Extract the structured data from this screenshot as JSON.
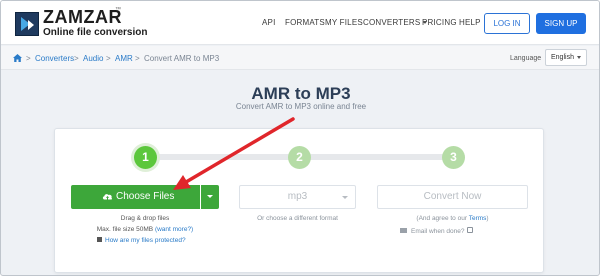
{
  "header": {
    "brand": "ZAMZAR",
    "trademark": "™",
    "tagline": "Online file conversion",
    "nav": [
      {
        "label": "API"
      },
      {
        "label": "FORMATS"
      },
      {
        "label": "MY FILES"
      },
      {
        "label": "CONVERTERS",
        "has_dropdown": true
      },
      {
        "label": "PRICING"
      },
      {
        "label": "HELP"
      }
    ],
    "login_label": "LOG IN",
    "signup_label": "SIGN UP"
  },
  "breadcrumb": {
    "home_icon": "home-icon",
    "separator": ">",
    "items": [
      "Converters",
      "Audio",
      "AMR",
      "Convert AMR to MP3"
    ]
  },
  "language": {
    "label": "Language",
    "selected": "English"
  },
  "page": {
    "title": "AMR to MP3",
    "subtitle": "Convert AMR to MP3 online and free"
  },
  "steps": [
    {
      "number": "1",
      "state": "active"
    },
    {
      "number": "2",
      "state": "inactive"
    },
    {
      "number": "3",
      "state": "inactive"
    }
  ],
  "upload": {
    "button_label": "Choose Files",
    "icon": "cloud-upload-icon",
    "drag_text": "Drag & drop files",
    "max_size_text": "Max. file size 50MB",
    "want_more": "(want more?)",
    "protected_link": "How are my files protected?"
  },
  "format": {
    "selected": "mp3",
    "hint": "Or choose a different format"
  },
  "convert": {
    "button_label": "Convert Now",
    "agree_prefix": "(And agree to our",
    "terms_link": "Terms",
    "agree_suffix": ")",
    "email_label": "Email when done?"
  },
  "colors": {
    "accent_green": "#3da73a",
    "step_active": "#5cc73c",
    "step_inactive": "#b5dca6",
    "link_blue": "#2a7bc8",
    "signup_blue": "#1f6fe0",
    "annotation_arrow": "#e0262b"
  }
}
